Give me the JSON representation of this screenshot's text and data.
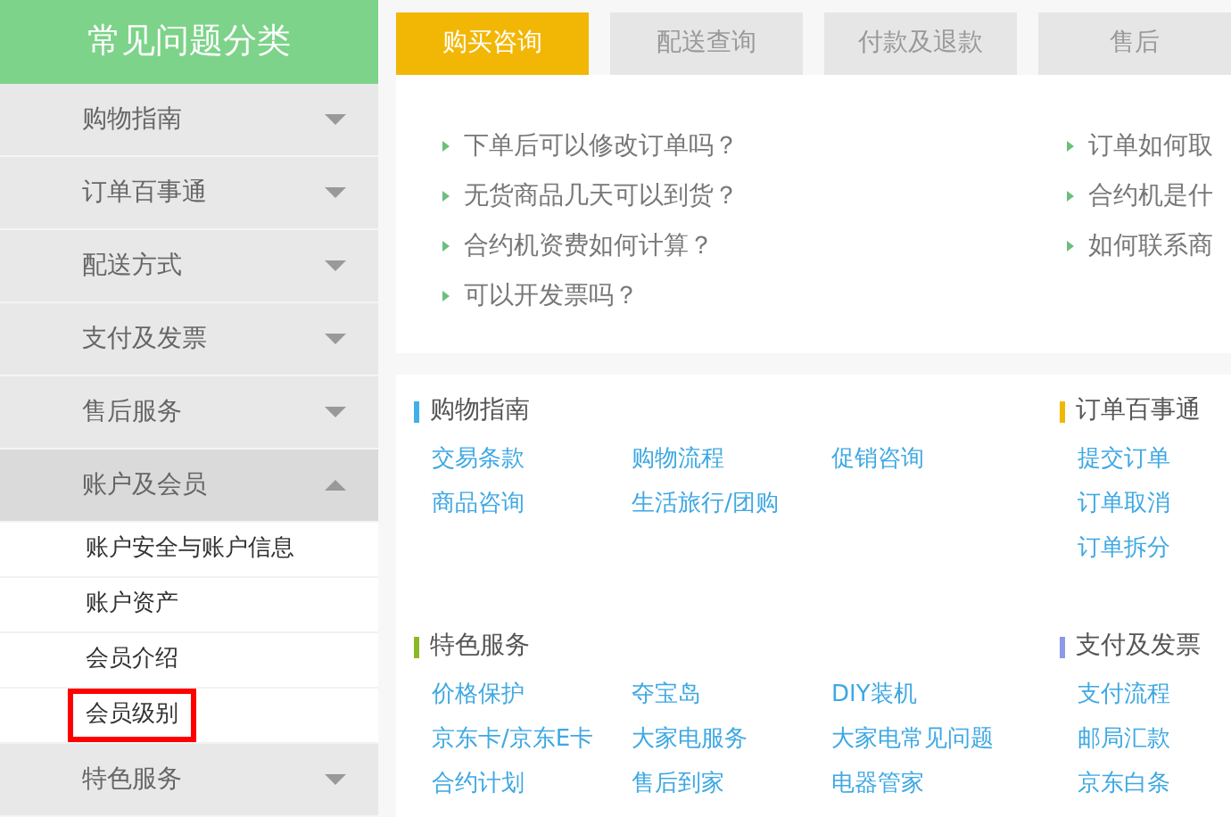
{
  "sidebar": {
    "title": "常见问题分类",
    "items": [
      {
        "label": "购物指南",
        "expanded": false
      },
      {
        "label": "订单百事通",
        "expanded": false
      },
      {
        "label": "配送方式",
        "expanded": false
      },
      {
        "label": "支付及发票",
        "expanded": false
      },
      {
        "label": "售后服务",
        "expanded": false
      },
      {
        "label": "账户及会员",
        "expanded": true,
        "children": [
          {
            "label": "账户安全与账户信息",
            "highlighted": false
          },
          {
            "label": "账户资产",
            "highlighted": false
          },
          {
            "label": "会员介绍",
            "highlighted": false
          },
          {
            "label": "会员级别",
            "highlighted": true
          }
        ]
      },
      {
        "label": "特色服务",
        "expanded": false
      }
    ]
  },
  "tabs": [
    {
      "label": "购买咨询",
      "selected": true
    },
    {
      "label": "配送查询",
      "selected": false
    },
    {
      "label": "付款及退款",
      "selected": false
    },
    {
      "label": "售后",
      "selected": false
    }
  ],
  "faq": {
    "columns": [
      [
        "下单后可以修改订单吗？",
        "无货商品几天可以到货？",
        "合约机资费如何计算？",
        "可以开发票吗？"
      ],
      [
        "订单如何取",
        "合约机是什",
        "如何联系商"
      ]
    ]
  },
  "sections": [
    {
      "title": "购物指南",
      "color": "#3fb0ea",
      "kind": "wide",
      "links": [
        "交易条款",
        "购物流程",
        "促销咨询",
        "商品咨询",
        "生活旅行/团购"
      ]
    },
    {
      "title": "订单百事通",
      "color": "#f2b705",
      "kind": "narrow",
      "links": [
        "提交订单",
        "订单取消",
        "订单拆分"
      ]
    },
    {
      "title": "特色服务",
      "color": "#8bb825",
      "kind": "wide",
      "links": [
        "价格保护",
        "夺宝岛",
        "DIY装机",
        "京东卡/京东E卡",
        "大家电服务",
        "大家电常见问题",
        "合约计划",
        "售后到家",
        "电器管家"
      ]
    },
    {
      "title": "支付及发票",
      "color": "#8a9ae6",
      "kind": "narrow",
      "links": [
        "支付流程",
        "邮局汇款",
        "京东白条"
      ]
    }
  ]
}
